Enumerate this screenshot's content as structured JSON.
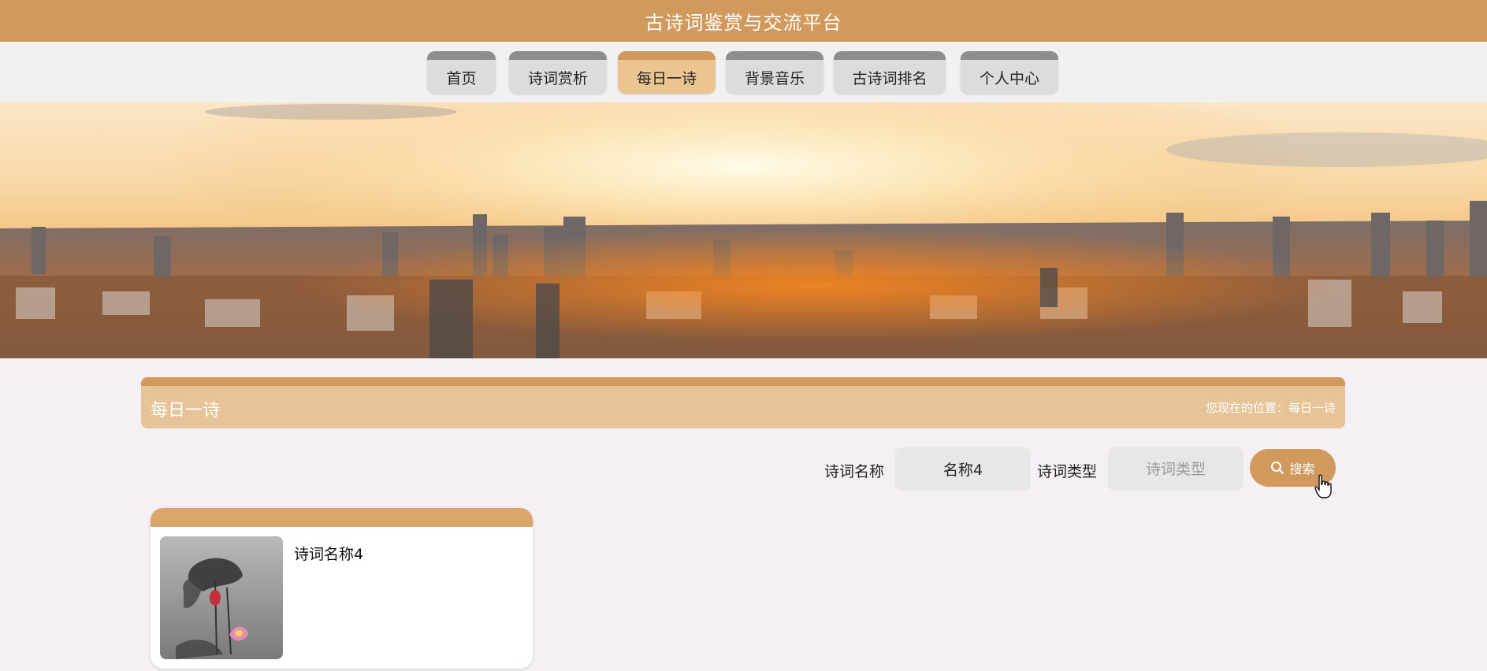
{
  "app": {
    "title": "古诗词鉴赏与交流平台"
  },
  "nav": {
    "items": [
      {
        "label": "首页"
      },
      {
        "label": "诗词赏析"
      },
      {
        "label": "每日一诗",
        "active": true
      },
      {
        "label": "背景音乐"
      },
      {
        "label": "古诗词排名"
      },
      {
        "label": "个人中心"
      }
    ]
  },
  "section": {
    "title": "每日一诗",
    "breadcrumb": "您现在的位置：每日一诗"
  },
  "search": {
    "name_label": "诗词名称",
    "name_value": "名称4",
    "type_label": "诗词类型",
    "type_placeholder": "诗词类型",
    "button_label": "搜索"
  },
  "list": {
    "items": [
      {
        "name": "诗词名称4"
      }
    ]
  },
  "colors": {
    "accent": "#d19a5c",
    "accent_light": "#ecc48f",
    "nav_bg": "#f1f1f1"
  },
  "icons": {
    "search": "search-icon",
    "cursor": "hand-cursor-icon"
  }
}
